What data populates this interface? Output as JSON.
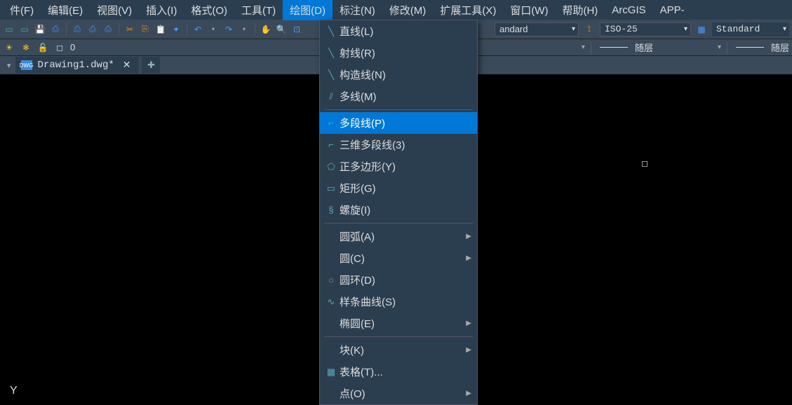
{
  "menubar": {
    "items": [
      {
        "label": "件(F)"
      },
      {
        "label": "编辑(E)"
      },
      {
        "label": "视图(V)"
      },
      {
        "label": "插入(I)"
      },
      {
        "label": "格式(O)"
      },
      {
        "label": "工具(T)"
      },
      {
        "label": "绘图(D)",
        "active": true
      },
      {
        "label": "标注(N)"
      },
      {
        "label": "修改(M)"
      },
      {
        "label": "扩展工具(X)"
      },
      {
        "label": "窗口(W)"
      },
      {
        "label": "帮助(H)"
      },
      {
        "label": "ArcGIS"
      },
      {
        "label": "APP-"
      }
    ]
  },
  "toolbar1": {
    "selectors": {
      "style1": "andard",
      "style2": "ISO-25",
      "style3": "Standard"
    }
  },
  "toolbar2": {
    "layer_value": "0",
    "layer_text1": "随层",
    "layer_text2": "随层"
  },
  "tabs": {
    "file_label": "Drawing1.dwg*"
  },
  "dropdown": {
    "items": [
      {
        "icon": "╲",
        "label": "直线(L)"
      },
      {
        "icon": "╲",
        "label": "射线(R)"
      },
      {
        "icon": "╲",
        "label": "构造线(N)"
      },
      {
        "icon": "⫽",
        "label": "多线(M)"
      },
      {
        "sep": true
      },
      {
        "icon": "⌐",
        "label": "多段线(P)",
        "highlighted": true
      },
      {
        "icon": "⌐",
        "label": "三维多段线(3)"
      },
      {
        "icon": "⬠",
        "label": "正多边形(Y)"
      },
      {
        "icon": "▭",
        "label": "矩形(G)"
      },
      {
        "icon": "§",
        "label": "螺旋(I)"
      },
      {
        "sep": true
      },
      {
        "icon": "",
        "label": "圆弧(A)",
        "submenu": true
      },
      {
        "icon": "",
        "label": "圆(C)",
        "submenu": true
      },
      {
        "icon": "○",
        "label": "圆环(D)"
      },
      {
        "icon": "∿",
        "label": "样条曲线(S)"
      },
      {
        "icon": "",
        "label": "椭圆(E)",
        "submenu": true
      },
      {
        "sep": true
      },
      {
        "icon": "",
        "label": "块(K)",
        "submenu": true
      },
      {
        "icon": "▦",
        "label": "表格(T)..."
      },
      {
        "icon": "",
        "label": "点(O)",
        "submenu": true
      }
    ]
  }
}
